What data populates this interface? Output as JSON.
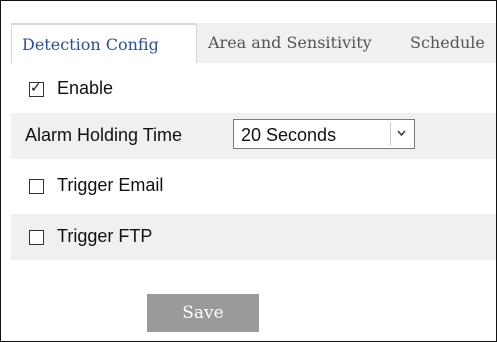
{
  "tabs": [
    {
      "label": "Detection Config",
      "active": true
    },
    {
      "label": "Area and Sensitivity",
      "active": false
    },
    {
      "label": "Schedule",
      "active": false
    }
  ],
  "enable": {
    "label": "Enable",
    "checked": true
  },
  "alarm_holding": {
    "label": "Alarm Holding Time",
    "value": "20 Seconds"
  },
  "trigger_email": {
    "label": "Trigger Email",
    "checked": false
  },
  "trigger_ftp": {
    "label": "Trigger FTP",
    "checked": false
  },
  "save_label": "Save",
  "icons": {
    "checkmark": "checkmark-icon",
    "dropdown": "chevron-down-icon"
  },
  "colors": {
    "active_tab_text": "#2a4fa0",
    "save_button": "#9a9a9a",
    "row_shade": "#f0f0f0"
  }
}
